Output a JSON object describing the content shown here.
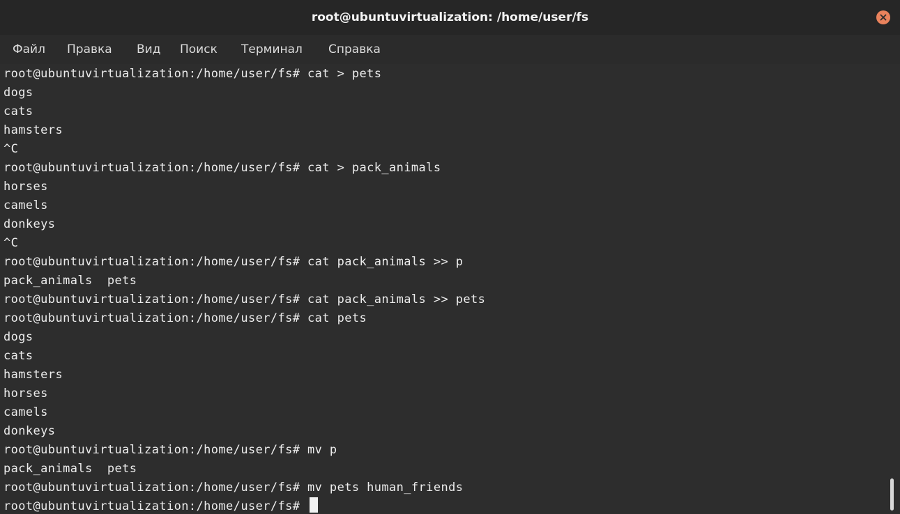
{
  "window": {
    "title": "root@ubuntuvirtualization: /home/user/fs",
    "close_icon": "close-icon",
    "close_color": "#e9825c"
  },
  "menu": {
    "items": [
      "Файл",
      "Правка",
      "Вид",
      "Поиск",
      "Терминал",
      "Справка"
    ]
  },
  "terminal": {
    "background": "#2d2d2d",
    "foreground": "#ececec",
    "lines": [
      "root@ubuntuvirtualization:/home/user/fs# cat > pets",
      "dogs",
      "cats",
      "hamsters",
      "^C",
      "root@ubuntuvirtualization:/home/user/fs# cat > pack_animals",
      "horses",
      "camels",
      "donkeys",
      "^C",
      "root@ubuntuvirtualization:/home/user/fs# cat pack_animals >> p",
      "pack_animals  pets",
      "root@ubuntuvirtualization:/home/user/fs# cat pack_animals >> pets",
      "root@ubuntuvirtualization:/home/user/fs# cat pets",
      "dogs",
      "cats",
      "hamsters",
      "horses",
      "camels",
      "donkeys",
      "root@ubuntuvirtualization:/home/user/fs# mv p",
      "pack_animals  pets",
      "root@ubuntuvirtualization:/home/user/fs# mv pets human_friends",
      "root@ubuntuvirtualization:/home/user/fs# "
    ]
  }
}
